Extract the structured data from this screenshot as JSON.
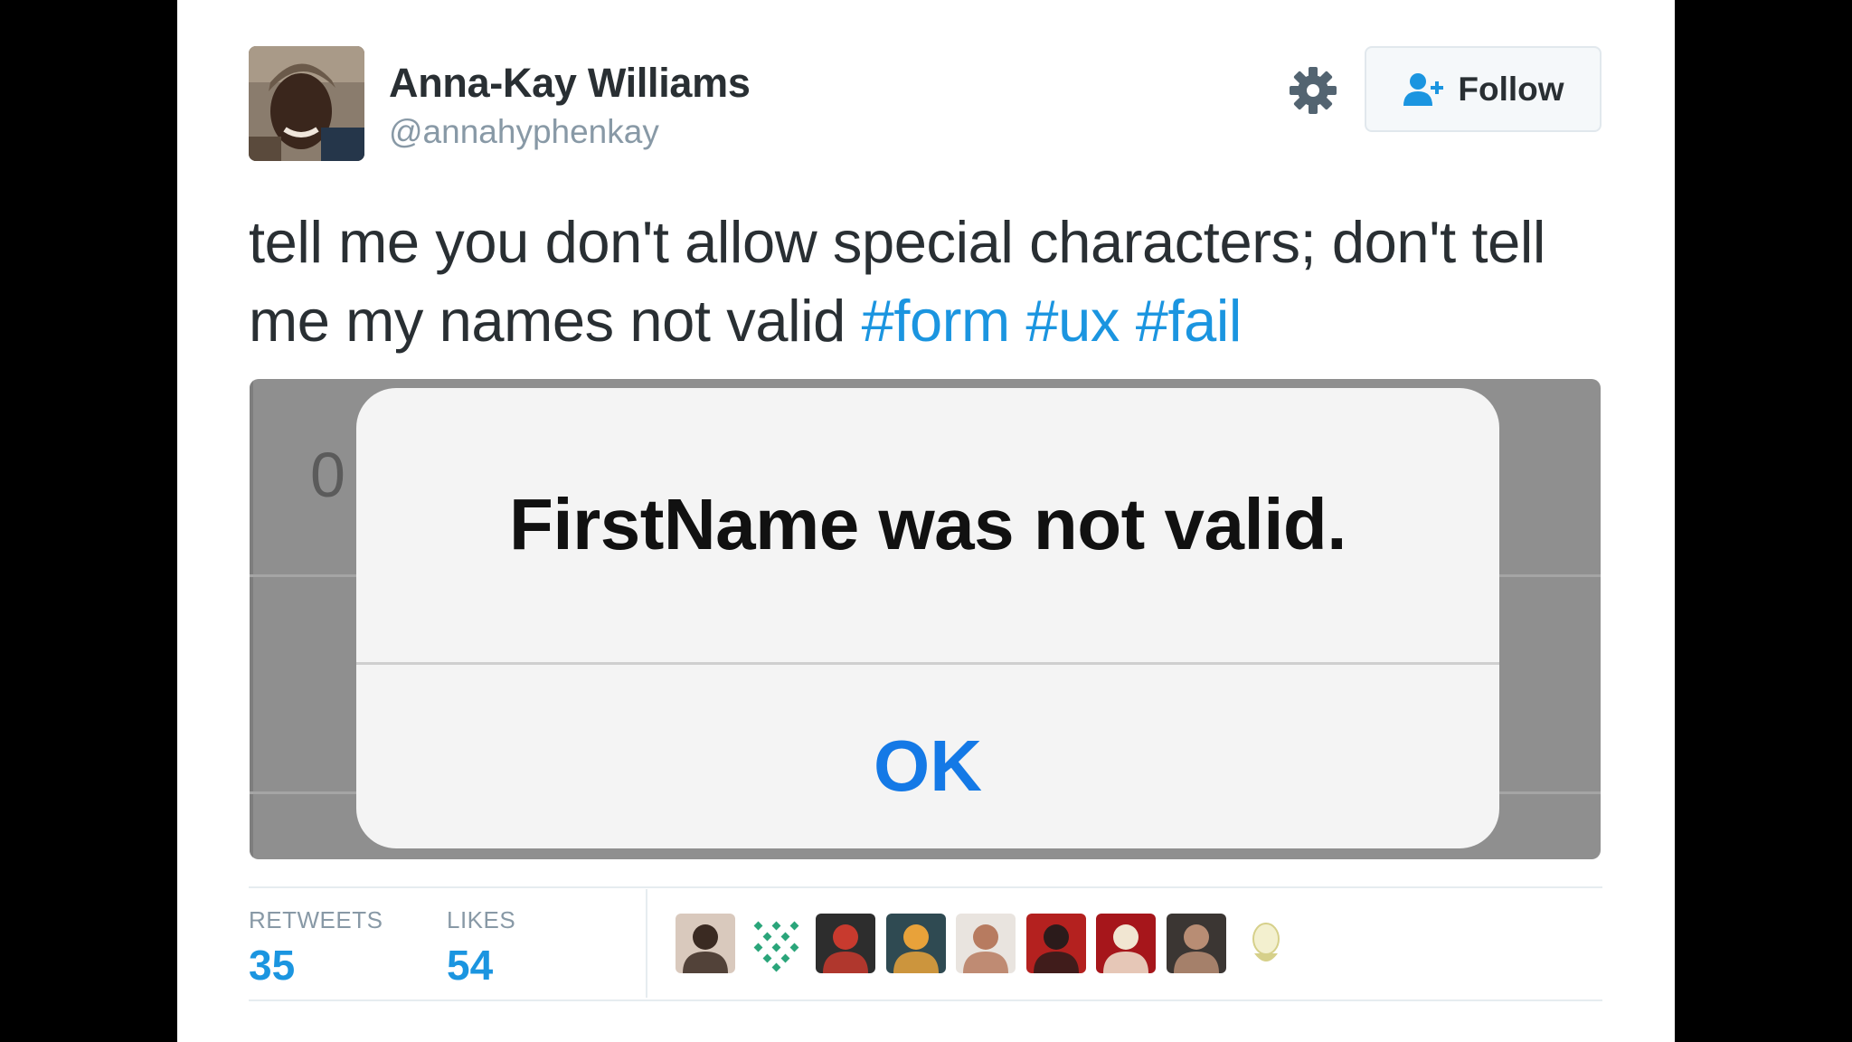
{
  "user": {
    "display_name": "Anna-Kay Williams",
    "handle": "@annahyphenkay"
  },
  "actions": {
    "follow_label": "Follow"
  },
  "tweet": {
    "text_before": "tell me you don't allow special characters; don't tell me my names not valid",
    "hashtags": [
      "#form",
      "#ux",
      "#fail"
    ]
  },
  "media": {
    "partial_text": "0",
    "alert_message": "FirstName was not valid.",
    "alert_button": "OK"
  },
  "stats": {
    "retweets_label": "RETWEETS",
    "retweets_count": "35",
    "likes_label": "LIKES",
    "likes_count": "54"
  },
  "colors": {
    "link": "#1b95e0",
    "ios_blue": "#1479e6",
    "text": "#292f33",
    "muted": "#8899a6"
  },
  "likers": [
    {
      "icon": "avatar-woman-dark-hair",
      "bg": "#d9c9bd",
      "fg": "#3a2a22"
    },
    {
      "icon": "avatar-green-pattern",
      "bg": "#ffffff",
      "fg": "#2aa57a"
    },
    {
      "icon": "avatar-man-red-shirt",
      "bg": "#2d2d2d",
      "fg": "#c83a2e"
    },
    {
      "icon": "avatar-rainbow-love",
      "bg": "#2f4a52",
      "fg": "#e8a23a"
    },
    {
      "icon": "avatar-older-woman",
      "bg": "#e9e4df",
      "fg": "#b77b60"
    },
    {
      "icon": "avatar-hat-figure",
      "bg": "#b4211f",
      "fg": "#2b1b1b"
    },
    {
      "icon": "avatar-mask-figure",
      "bg": "#a6161b",
      "fg": "#f1e6d2"
    },
    {
      "icon": "avatar-woman-dark",
      "bg": "#3b3633",
      "fg": "#b88d74"
    },
    {
      "icon": "avatar-default-egg",
      "bg": "#ffffff",
      "fg": "#d6d08a"
    }
  ]
}
